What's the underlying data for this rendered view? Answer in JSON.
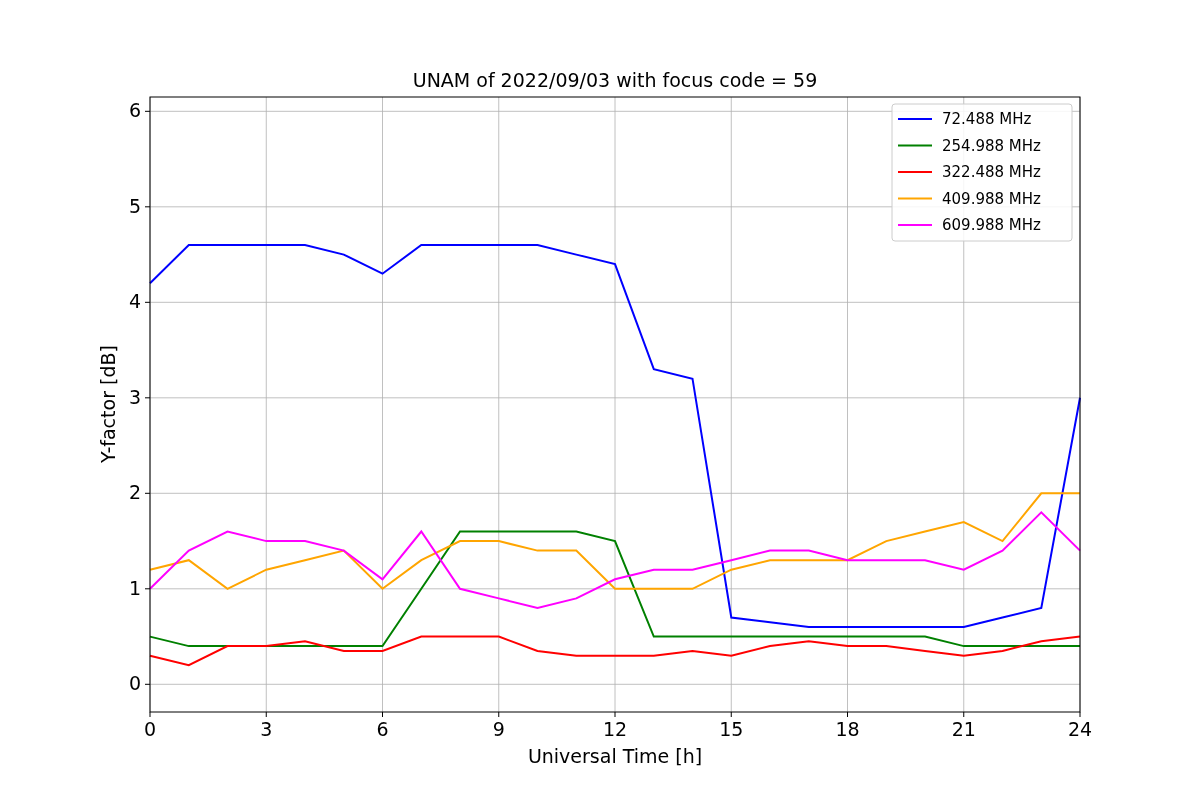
{
  "figure": {
    "chart_data": {
      "type": "line",
      "title": "UNAM of 2022/09/03 with focus code = 59",
      "xlabel": "Universal Time [h]",
      "ylabel": "Y-factor [dB]",
      "x": [
        0,
        1,
        2,
        3,
        4,
        5,
        6,
        7,
        8,
        9,
        10,
        11,
        12,
        13,
        14,
        15,
        16,
        17,
        18,
        19,
        20,
        21,
        22,
        23,
        24
      ],
      "grid": true,
      "legend": true,
      "xlim": [
        0,
        24
      ],
      "ylim": [
        -0.29,
        6.15
      ],
      "xticks": [
        0,
        3,
        6,
        9,
        12,
        15,
        18,
        21,
        24
      ],
      "yticks": [
        0,
        1,
        2,
        3,
        4,
        5,
        6
      ],
      "series": [
        {
          "name": "72.488 MHz",
          "color": "#0000ff",
          "values": [
            4.2,
            4.6,
            4.6,
            4.6,
            4.6,
            4.5,
            4.3,
            4.6,
            4.6,
            4.6,
            4.6,
            4.5,
            4.4,
            3.3,
            3.2,
            0.7,
            0.65,
            0.6,
            0.6,
            0.6,
            0.6,
            0.6,
            0.7,
            0.8,
            3.0
          ]
        },
        {
          "name": "254.988 MHz",
          "color": "#008000",
          "values": [
            0.5,
            0.4,
            0.4,
            0.4,
            0.4,
            0.4,
            0.4,
            1.0,
            1.6,
            1.6,
            1.6,
            1.6,
            1.5,
            0.5,
            0.5,
            0.5,
            0.5,
            0.5,
            0.5,
            0.5,
            0.5,
            0.4,
            0.4,
            0.4,
            0.4
          ]
        },
        {
          "name": "322.488 MHz",
          "color": "#ff0000",
          "values": [
            0.3,
            0.2,
            0.4,
            0.4,
            0.45,
            0.35,
            0.35,
            0.5,
            0.5,
            0.5,
            0.35,
            0.3,
            0.3,
            0.3,
            0.35,
            0.3,
            0.4,
            0.45,
            0.4,
            0.4,
            0.35,
            0.3,
            0.35,
            0.45,
            0.5
          ]
        },
        {
          "name": "409.988 MHz",
          "color": "#ffa500",
          "values": [
            1.2,
            1.3,
            1.0,
            1.2,
            1.3,
            1.4,
            1.0,
            1.3,
            1.5,
            1.5,
            1.4,
            1.4,
            1.0,
            1.0,
            1.0,
            1.2,
            1.3,
            1.3,
            1.3,
            1.5,
            1.6,
            1.7,
            1.5,
            2.0,
            2.0
          ]
        },
        {
          "name": "609.988 MHz",
          "color": "#ff00ff",
          "values": [
            1.0,
            1.4,
            1.6,
            1.5,
            1.5,
            1.4,
            1.1,
            1.6,
            1.0,
            0.9,
            0.8,
            0.9,
            1.1,
            1.2,
            1.2,
            1.3,
            1.4,
            1.4,
            1.3,
            1.3,
            1.3,
            1.2,
            1.4,
            1.8,
            1.4
          ]
        }
      ]
    }
  }
}
